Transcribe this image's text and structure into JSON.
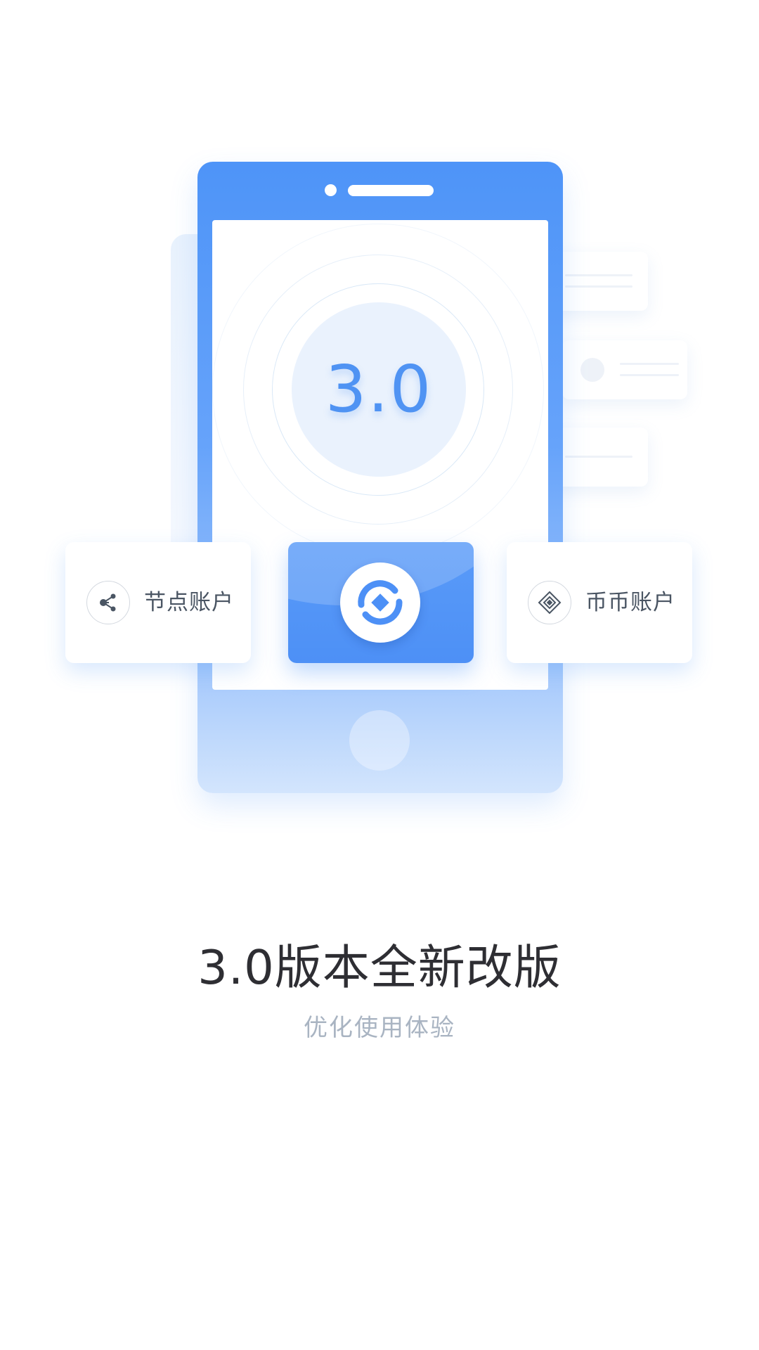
{
  "illustration": {
    "version_badge": "3.0",
    "cards": {
      "left": {
        "label": "节点账户",
        "icon": "node-share-icon"
      },
      "center": {
        "icon": "app-logo-icon"
      },
      "right": {
        "label": "币币账户",
        "icon": "exchange-diamond-icon"
      }
    }
  },
  "headline": "3.0版本全新改版",
  "subline": "优化使用体验",
  "colors": {
    "brand_blue": "#4e94f8",
    "headline": "#2e2e33",
    "subline": "#a9b4c2"
  }
}
